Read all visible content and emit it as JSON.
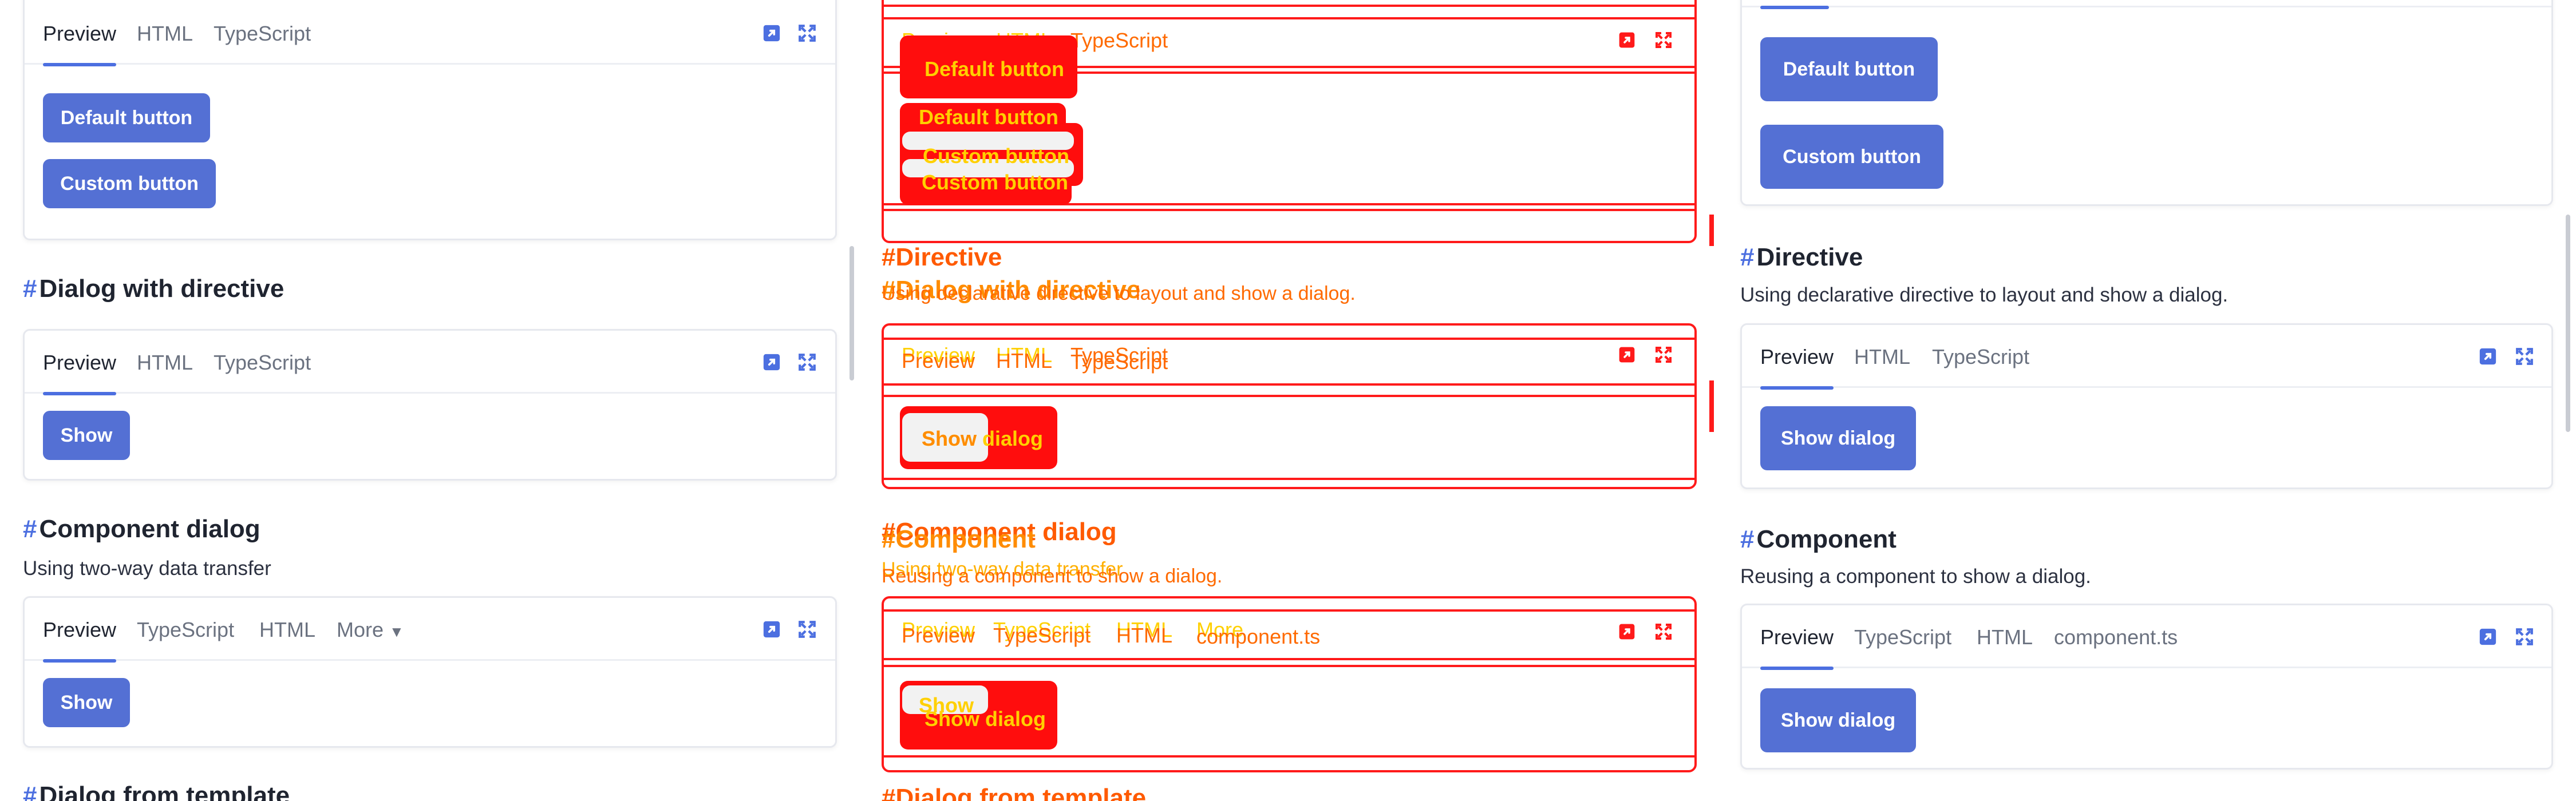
{
  "tabs": {
    "preview": "Preview",
    "html": "HTML",
    "typescript": "TypeScript",
    "more": "More",
    "component_ts": "component.ts"
  },
  "icons": {
    "open_external": "external-link-icon",
    "fullscreen": "fullscreen-icon",
    "caret": "chevron-down-icon"
  },
  "left": {
    "default_button": "Default button",
    "custom_button": "Custom button",
    "dialog_directive_title": "Dialog with directive",
    "show_button": "Show",
    "component_dialog_title": "Component dialog",
    "component_dialog_desc": "Using two-way data transfer",
    "dialog_template_title": "Dialog from template"
  },
  "right": {
    "default_button": "Default button",
    "custom_button": "Custom button",
    "directive_title": "Directive",
    "directive_desc": "Using declarative directive to layout and show a dialog.",
    "show_dialog_button": "Show dialog",
    "component_title": "Component",
    "component_desc": "Reusing a component to show a dialog."
  },
  "hash": "#",
  "colors": {
    "accent": "#4c6fe0",
    "button": "#5470d4",
    "diff_red": "#ff1a1a",
    "diff_yellow": "#ffd000",
    "diff_orange": "#ff6a00"
  }
}
